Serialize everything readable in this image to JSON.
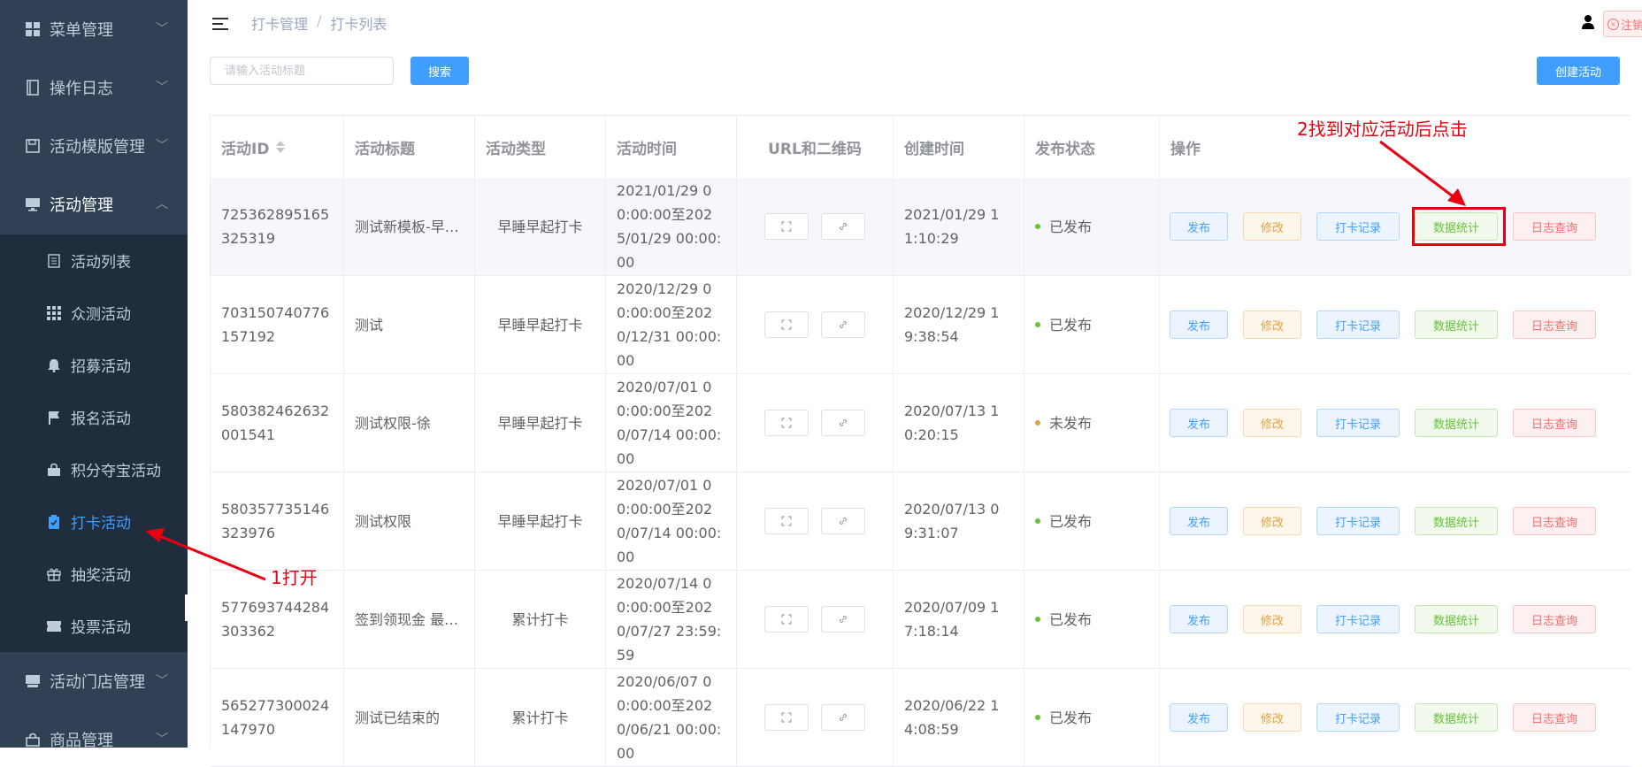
{
  "sidebar": {
    "menus": [
      {
        "label": "菜单管理",
        "icon": "grid-icon"
      },
      {
        "label": "操作日志",
        "icon": "notebook-icon"
      },
      {
        "label": "活动模版管理",
        "icon": "save-icon"
      },
      {
        "label": "活动管理",
        "icon": "monitor-icon"
      }
    ],
    "submenus": [
      {
        "label": "活动列表",
        "icon": "list-icon"
      },
      {
        "label": "众测活动",
        "icon": "apps-icon"
      },
      {
        "label": "招募活动",
        "icon": "bell-icon"
      },
      {
        "label": "报名活动",
        "icon": "flag-icon"
      },
      {
        "label": "积分夺宝活动",
        "icon": "bag-icon"
      },
      {
        "label": "打卡活动",
        "icon": "checklist-icon"
      },
      {
        "label": "抽奖活动",
        "icon": "gift-icon"
      },
      {
        "label": "投票活动",
        "icon": "ticket-icon"
      }
    ],
    "menus_bottom": [
      {
        "label": "活动门店管理",
        "icon": "store-icon"
      },
      {
        "label": "商品管理",
        "icon": "bag-icon"
      }
    ]
  },
  "header": {
    "breadcrumb": [
      "打卡管理",
      "打卡列表"
    ],
    "breadcrumb_sep": "/",
    "logout_label": "注销"
  },
  "toolbar": {
    "search_placeholder": "请输入活动标题",
    "search_label": "搜索",
    "create_label": "创建活动"
  },
  "table": {
    "columns": [
      "活动ID",
      "活动标题",
      "活动类型",
      "活动时间",
      "URL和二维码",
      "创建时间",
      "发布状态",
      "操作"
    ],
    "actions": [
      "发布",
      "修改",
      "打卡记录",
      "数据统计",
      "日志查询"
    ],
    "rows": [
      {
        "id": "725362895165325319",
        "title": "测试新模板-早…",
        "type": "早睡早起打卡",
        "time": "2021/01/29 00:00:00至2025/01/29 00:00:00",
        "created": "2021/01/29 11:10:29",
        "status": "已发布",
        "status_color": "#67c23a"
      },
      {
        "id": "703150740776157192",
        "title": "测试",
        "type": "早睡早起打卡",
        "time": "2020/12/29 00:00:00至2020/12/31 00:00:00",
        "created": "2020/12/29 19:38:54",
        "status": "已发布",
        "status_color": "#67c23a"
      },
      {
        "id": "580382462632001541",
        "title": "测试权限-徐",
        "type": "早睡早起打卡",
        "time": "2020/07/01 00:00:00至2020/07/14 00:00:00",
        "created": "2020/07/13 10:20:15",
        "status": "未发布",
        "status_color": "#e6a23c"
      },
      {
        "id": "580357735146323976",
        "title": "测试权限",
        "type": "早睡早起打卡",
        "time": "2020/07/01 00:00:00至2020/07/14 00:00:00",
        "created": "2020/07/13 09:31:07",
        "status": "已发布",
        "status_color": "#67c23a"
      },
      {
        "id": "577693744284303362",
        "title": "签到领现金 最…",
        "type": "累计打卡",
        "time": "2020/07/14 00:00:00至2020/07/27 23:59:59",
        "created": "2020/07/09 17:18:14",
        "status": "已发布",
        "status_color": "#67c23a"
      },
      {
        "id": "565277300024147970",
        "title": "测试已结束的",
        "type": "累计打卡",
        "time": "2020/06/07 00:00:00至2020/06/21 00:00:00",
        "created": "2020/06/22 14:08:59",
        "status": "已发布",
        "status_color": "#67c23a"
      }
    ]
  },
  "annotations": {
    "note1": "1打开",
    "note2": "2找到对应活动后点击",
    "color": "#e60012"
  },
  "colors": {
    "sidebar_bg": "#304156",
    "submenu_bg": "#1f2d3d",
    "primary": "#409eff"
  }
}
